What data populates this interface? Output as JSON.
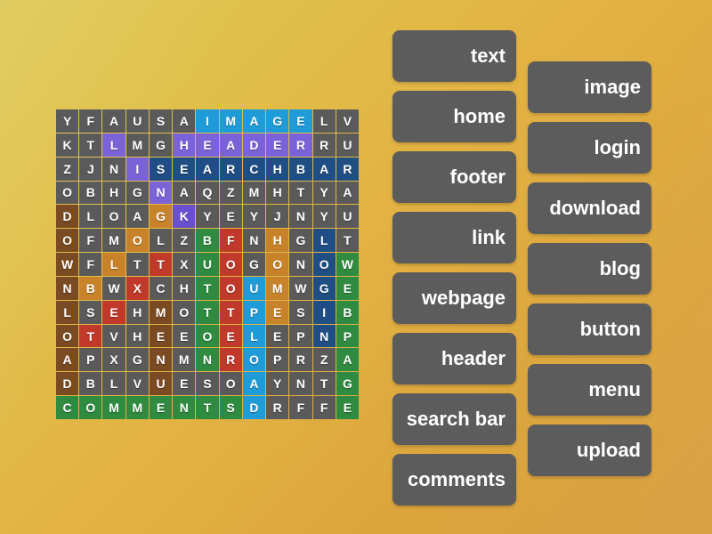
{
  "theme": {
    "bg_top_left": "#ddc750",
    "bg_bottom_right": "#d69a37",
    "chip_bg": "#5c5c5c",
    "cell_default_bg": "#5a5a5a",
    "cell_text": "#ffffff",
    "highlight_colors": {
      "cyan": "#1f9bd8",
      "blue": "#1d8bd4",
      "navy": "#1f4e85",
      "steel": "#2b5f9e",
      "purple": "#6a4fd0",
      "violet": "#7a63d8",
      "green": "#2e8b3f",
      "red": "#c0392b",
      "orange": "#c8832a",
      "brown": "#7a4a22",
      "dark_brown": "#5e3a1c"
    }
  },
  "grid": {
    "rows": 12,
    "cols": 13,
    "letters": [
      [
        "Y",
        "F",
        "A",
        "U",
        "S",
        "A",
        "I",
        "M",
        "A",
        "G",
        "E",
        "L",
        "V"
      ],
      [
        "K",
        "T",
        "L",
        "M",
        "G",
        "H",
        "E",
        "A",
        "D",
        "E",
        "R",
        "R",
        "U"
      ],
      [
        "Z",
        "J",
        "N",
        "I",
        "S",
        "E",
        "A",
        "R",
        "C",
        "H",
        "B",
        "A",
        "R"
      ],
      [
        "O",
        "B",
        "H",
        "G",
        "N",
        "A",
        "Q",
        "Z",
        "M",
        "H",
        "T",
        "Y",
        "A"
      ],
      [
        "D",
        "L",
        "O",
        "A",
        "G",
        "K",
        "Y",
        "E",
        "Y",
        "J",
        "N",
        "Y",
        "U"
      ],
      [
        "O",
        "F",
        "M",
        "O",
        "L",
        "Z",
        "B",
        "F",
        "N",
        "H",
        "G",
        "L",
        "T"
      ],
      [
        "W",
        "F",
        "L",
        "T",
        "T",
        "X",
        "U",
        "O",
        "G",
        "O",
        "N",
        "O",
        "W"
      ],
      [
        "N",
        "B",
        "W",
        "X",
        "C",
        "H",
        "T",
        "O",
        "U",
        "M",
        "W",
        "G",
        "E"
      ],
      [
        "L",
        "S",
        "E",
        "H",
        "M",
        "O",
        "T",
        "T",
        "P",
        "E",
        "S",
        "I",
        "B"
      ],
      [
        "O",
        "T",
        "V",
        "H",
        "E",
        "E",
        "O",
        "E",
        "L",
        "E",
        "P",
        "N",
        "P"
      ],
      [
        "A",
        "P",
        "X",
        "G",
        "N",
        "M",
        "N",
        "R",
        "O",
        "P",
        "R",
        "Z",
        "A"
      ],
      [
        "D",
        "B",
        "L",
        "V",
        "U",
        "E",
        "S",
        "O",
        "A",
        "Y",
        "N",
        "T",
        "G"
      ],
      [
        "C",
        "O",
        "M",
        "M",
        "E",
        "N",
        "T",
        "S",
        "D",
        "R",
        "F",
        "F",
        "E"
      ]
    ],
    "colors": [
      [
        "d",
        "d",
        "d",
        "d",
        "d",
        "d",
        "cyan",
        "cyan",
        "cyan",
        "cyan",
        "cyan",
        "d",
        "d"
      ],
      [
        "d",
        "d",
        "violet",
        "d",
        "d",
        "violet",
        "violet",
        "violet",
        "violet",
        "violet",
        "violet",
        "d",
        "d"
      ],
      [
        "d",
        "d",
        "d",
        "violet",
        "navy",
        "navy",
        "navy",
        "navy",
        "navy",
        "navy",
        "navy",
        "navy",
        "navy"
      ],
      [
        "d",
        "d",
        "d",
        "d",
        "violet",
        "d",
        "d",
        "d",
        "d",
        "d",
        "d",
        "d",
        "d"
      ],
      [
        "brown",
        "d",
        "d",
        "d",
        "orange",
        "purple",
        "d",
        "d",
        "d",
        "d",
        "d",
        "d",
        "d"
      ],
      [
        "brown",
        "d",
        "d",
        "orange",
        "d",
        "d",
        "green",
        "red",
        "d",
        "orange",
        "d",
        "navy",
        "d"
      ],
      [
        "brown",
        "d",
        "orange",
        "d",
        "red",
        "d",
        "green",
        "red",
        "d",
        "orange",
        "d",
        "navy",
        "green"
      ],
      [
        "brown",
        "orange",
        "d",
        "red",
        "d",
        "d",
        "green",
        "red",
        "cyan",
        "orange",
        "d",
        "navy",
        "green"
      ],
      [
        "brown",
        "d",
        "red",
        "d",
        "brown",
        "d",
        "green",
        "red",
        "cyan",
        "orange",
        "d",
        "navy",
        "green"
      ],
      [
        "brown",
        "red",
        "d",
        "d",
        "brown",
        "d",
        "green",
        "red",
        "cyan",
        "d",
        "d",
        "navy",
        "green"
      ],
      [
        "brown",
        "d",
        "d",
        "d",
        "brown",
        "d",
        "green",
        "red",
        "cyan",
        "d",
        "d",
        "d",
        "green"
      ],
      [
        "brown",
        "d",
        "d",
        "d",
        "brown",
        "d",
        "d",
        "d",
        "cyan",
        "d",
        "d",
        "d",
        "green"
      ],
      [
        "green",
        "green",
        "green",
        "green",
        "green",
        "green",
        "green",
        "green",
        "cyan",
        "d",
        "d",
        "d",
        "green"
      ]
    ]
  },
  "word_list": {
    "left_column": [
      {
        "label": "text",
        "found": false
      },
      {
        "label": "home",
        "found": false
      },
      {
        "label": "footer",
        "found": false
      },
      {
        "label": "link",
        "found": false
      },
      {
        "label": "webpage",
        "found": false
      },
      {
        "label": "header",
        "found": false
      },
      {
        "label": "search bar",
        "found": false
      },
      {
        "label": "comments",
        "found": false
      }
    ],
    "right_column": [
      {
        "label": "image",
        "found": false
      },
      {
        "label": "login",
        "found": false
      },
      {
        "label": "download",
        "found": false
      },
      {
        "label": "blog",
        "found": false
      },
      {
        "label": "button",
        "found": false
      },
      {
        "label": "menu",
        "found": false
      },
      {
        "label": "upload",
        "found": false
      }
    ]
  }
}
